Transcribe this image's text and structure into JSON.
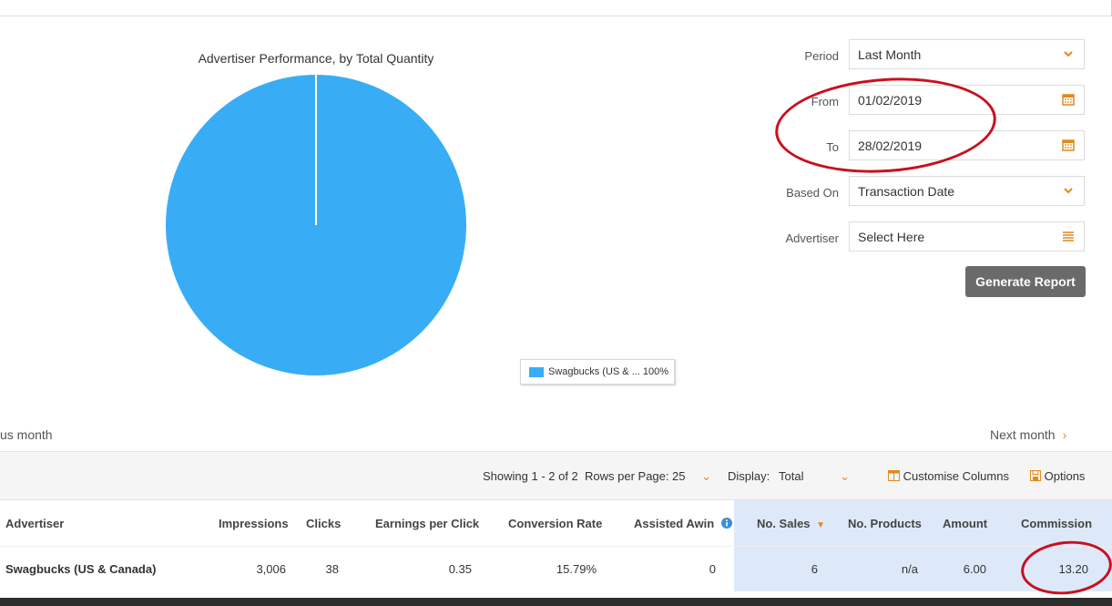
{
  "chart": {
    "title": "Advertiser Performance, by Total Quantity",
    "legend_label": "Swagbucks (US & ... 100%"
  },
  "chart_data": {
    "type": "pie",
    "title": "Advertiser Performance, by Total Quantity",
    "slices": [
      {
        "label": "Swagbucks (US & ...",
        "value": 100,
        "color": "#38adf5"
      }
    ],
    "legend": "bottom-right"
  },
  "filters": {
    "period_label": "Period",
    "period_value": "Last Month",
    "from_label": "From",
    "from_value": "01/02/2019",
    "to_label": "To",
    "to_value": "28/02/2019",
    "based_on_label": "Based On",
    "based_on_value": "Transaction Date",
    "advertiser_label": "Advertiser",
    "advertiser_value": "Select Here",
    "generate_label": "Generate Report"
  },
  "pager": {
    "prev": "us month",
    "next": "Next month"
  },
  "toolbar": {
    "showing": "Showing 1 - 2 of 2",
    "rows_per_page_label": "Rows per Page:",
    "rows_per_page_value": "25",
    "display_label": "Display:",
    "display_value": "Total",
    "customise": "Customise Columns",
    "options": "Options"
  },
  "table": {
    "headers": [
      "Advertiser",
      "Impressions",
      "Clicks",
      "Earnings per Click",
      "Conversion Rate",
      "Assisted Awin",
      "No. Sales",
      "No. Products",
      "Amount",
      "Commission"
    ],
    "rows": [
      [
        "Swagbucks (US & Canada)",
        "3,006",
        "38",
        "0.35",
        "15.79%",
        "0",
        "6",
        "n/a",
        "6.00",
        "13.20"
      ]
    ]
  },
  "colors": {
    "pie": "#38adf5",
    "accent": "#e08a1e",
    "button": "#6a6a6a",
    "annotation": "#c8101e",
    "highlight": "#dde9f8"
  }
}
